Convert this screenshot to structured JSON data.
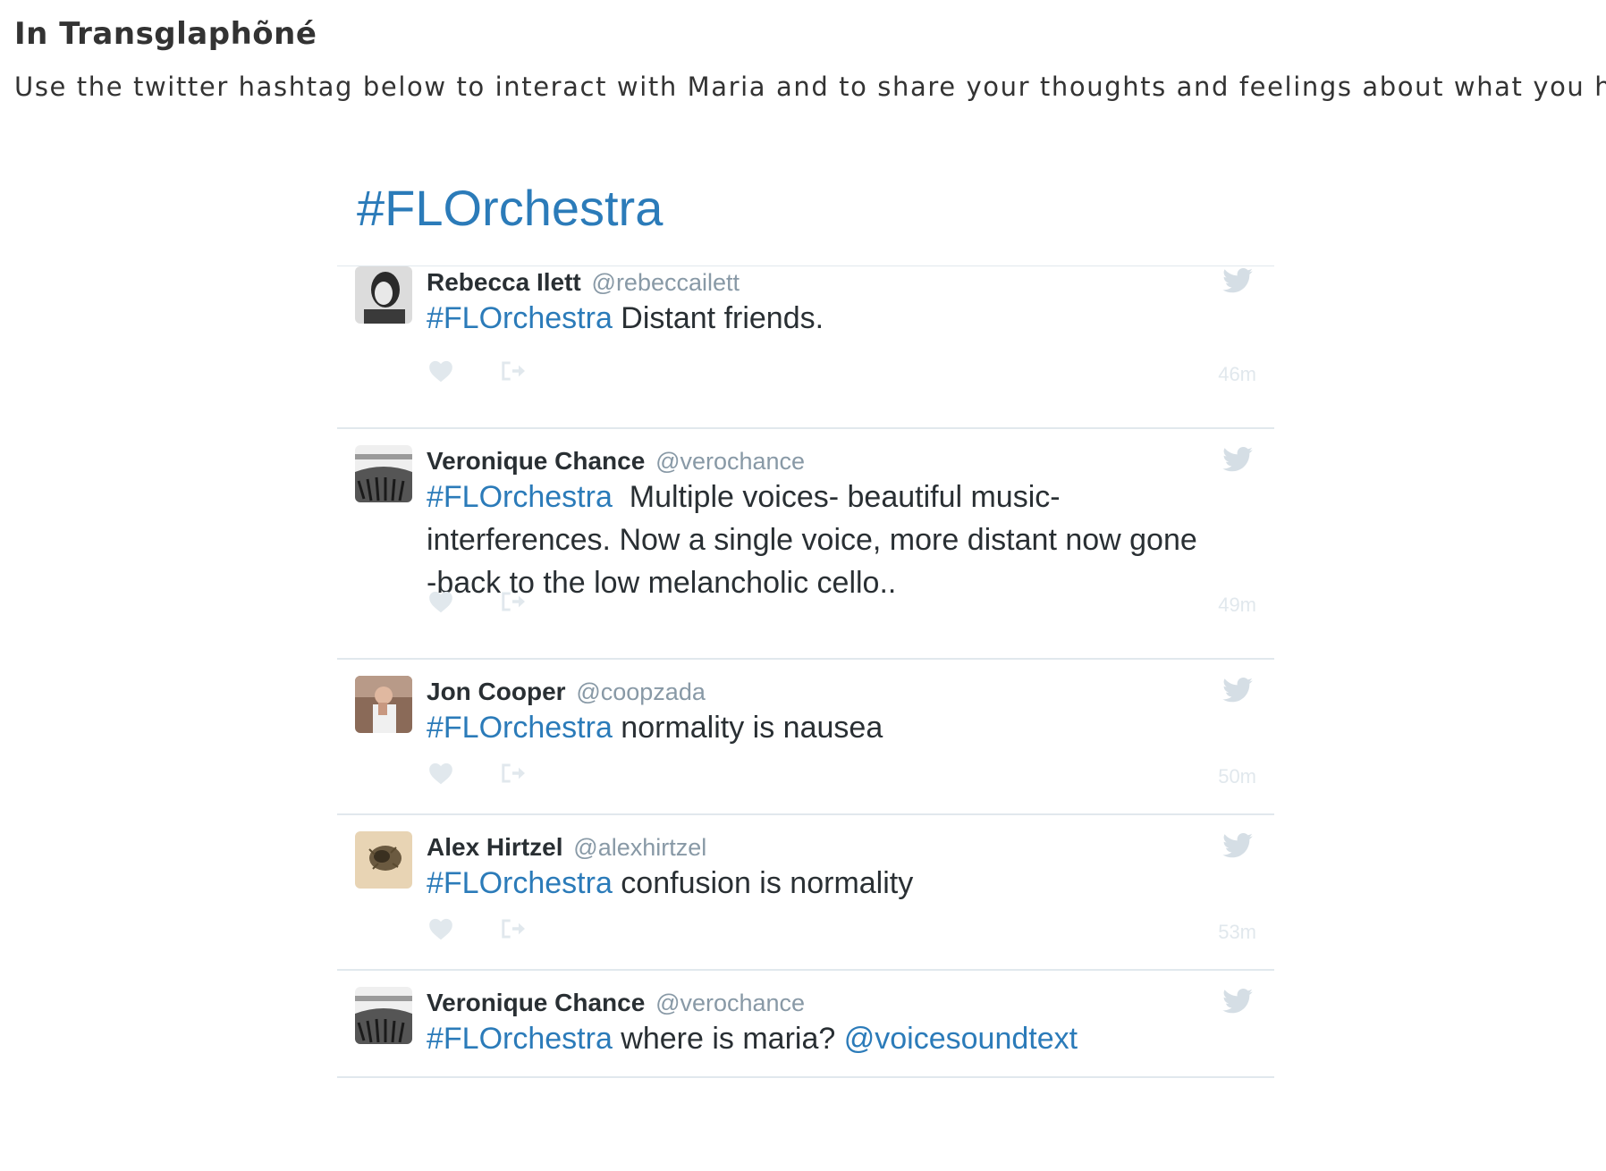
{
  "page": {
    "heading": "In Transglaphõné",
    "intro": "Use the twitter hashtag below to interact with Maria and to share your thoughts and feelings about what you hear."
  },
  "timeline": {
    "title": "#FLOrchestra",
    "tweets": [
      {
        "name": "Rebecca Ilett",
        "handle": "@rebeccailett",
        "hashtag": "#FLOrchestra",
        "text": " Distant friends.",
        "time": "46m"
      },
      {
        "name": "Veronique Chance",
        "handle": "@verochance",
        "hashtag": "#FLOrchestra",
        "text": "  Multiple voices- beautiful music- interferences. Now a single voice, more distant now gone -back to the low melancholic cello..",
        "time": "49m"
      },
      {
        "name": "Jon Cooper",
        "handle": "@coopzada",
        "hashtag": "#FLOrchestra",
        "text": " normality is nausea",
        "time": "50m"
      },
      {
        "name": "Alex Hirtzel",
        "handle": "@alexhirtzel",
        "hashtag": "#FLOrchestra",
        "text": " confusion is normality",
        "time": "53m"
      },
      {
        "name": "Veronique Chance",
        "handle": "@verochance",
        "hashtag": "#FLOrchestra",
        "text": " where is maria? ",
        "mention": "@voicesoundtext",
        "time": ""
      }
    ]
  },
  "colors": {
    "link": "#2b7bb9",
    "handle": "#8899a6",
    "divider": "#e1e8ed",
    "text": "#292f33"
  },
  "icons": {
    "tweet_brand": "twitter-bird-icon",
    "like": "heart-icon",
    "share": "share-icon"
  }
}
